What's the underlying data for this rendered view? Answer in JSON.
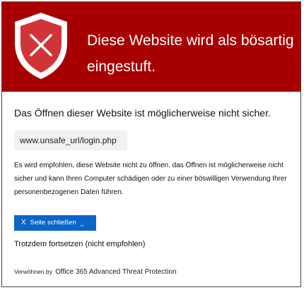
{
  "banner": {
    "title": "Diese Website wird als bösartig eingestuft.",
    "icon": "shield-x-icon",
    "color": "#a80000"
  },
  "main": {
    "warning": "Das Öffnen dieser Website ist möglicherweise nicht sicher.",
    "url": "www.unsafe_url/login.php",
    "recommendation": "Es wird empfohlen, diese Website nicht zu öffnen. das Öffnen ist möglicherweise nicht sicher und kann Ihren Computer schädigen oder zu einer böswilligen Verwendung Ihrer personenbezogenen Daten führen.",
    "close_button": {
      "icon_glyph": "X",
      "label": "Seite schließen",
      "trailing": "_",
      "color": "#0a66c8"
    },
    "continue_link": "Trotzdem fortsetzen (nicht empfohlen)"
  },
  "footer": {
    "prefix": "Verwöhnen by",
    "product": "Office 365 Advanced Threat Protection"
  }
}
